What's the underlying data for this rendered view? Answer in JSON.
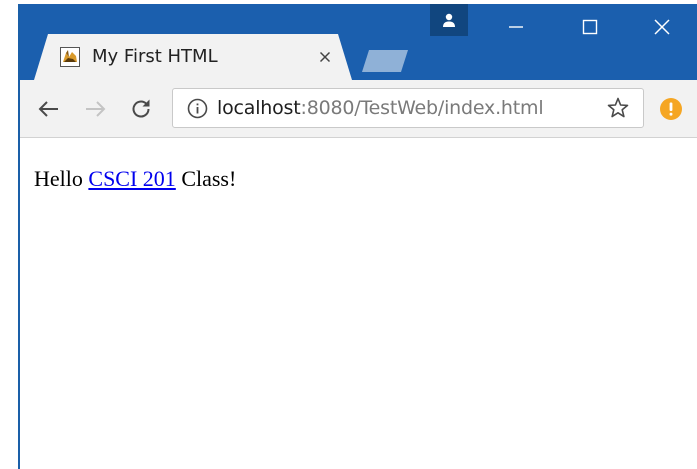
{
  "colors": {
    "titlebar": "#1b5fae",
    "profile_button": "#11467f",
    "tab_background": "#f2f2f2",
    "new_tab": "#8fb1d7",
    "link": "#0000ee",
    "alert": "#f5a623"
  },
  "window": {
    "profile_icon": "person-icon",
    "minimize_icon": "minimize-icon",
    "maximize_icon": "maximize-icon",
    "close_icon": "close-icon"
  },
  "tab": {
    "title": "My First HTML",
    "favicon": "tomcat-favicon",
    "close_icon": "close-icon"
  },
  "toolbar": {
    "back_icon": "back-arrow-icon",
    "forward_icon": "forward-arrow-icon",
    "reload_icon": "reload-icon",
    "address": {
      "security_icon": "info-icon",
      "host": "localhost",
      "rest": ":8080/TestWeb/index.html"
    },
    "bookmark_icon": "star-icon",
    "menu_icon": "alert-icon"
  },
  "page": {
    "text_before": "Hello ",
    "link_text": "CSCI 201",
    "text_after": " Class!"
  }
}
